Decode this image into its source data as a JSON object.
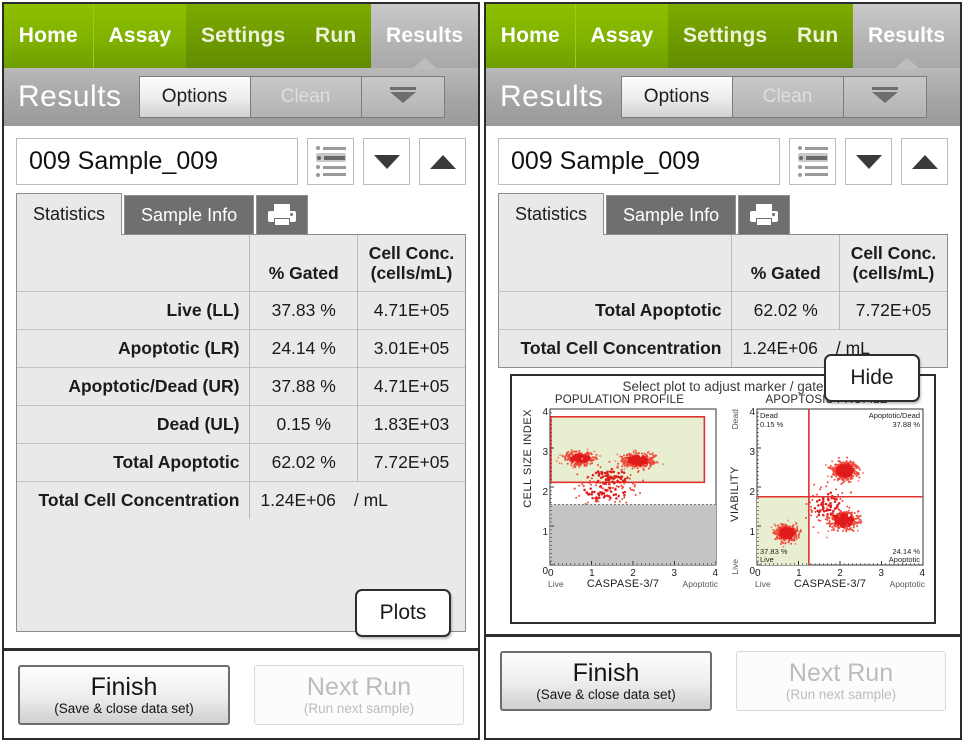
{
  "nav": {
    "tabs": [
      {
        "label": "Home",
        "state": "bright"
      },
      {
        "label": "Assay",
        "state": "bright"
      },
      {
        "label": "Settings",
        "state": "dark"
      },
      {
        "label": "Run",
        "state": "dark"
      },
      {
        "label": "Results",
        "state": "active"
      }
    ]
  },
  "titlebar": {
    "title": "Results",
    "options_label": "Options",
    "clean_label": "Clean",
    "more_icon": "chevron-down-icon"
  },
  "sample": {
    "value": "009 Sample_009",
    "list_icon": "list-icon",
    "prev_icon": "triangle-down-icon",
    "next_icon": "triangle-up-icon"
  },
  "tabs": {
    "statistics": "Statistics",
    "sample_info": "Sample Info",
    "print_icon": "printer-icon"
  },
  "table": {
    "headers": [
      "",
      "% Gated",
      "Cell Conc.\n(cells/mL)"
    ],
    "header_pct": "% Gated",
    "header_conc_line1": "Cell Conc.",
    "header_conc_line2": "(cells/mL)",
    "rows_full": [
      {
        "label": "Live (LL)",
        "pct": "37.83 %",
        "conc": "4.71E+05"
      },
      {
        "label": "Apoptotic (LR)",
        "pct": "24.14 %",
        "conc": "3.01E+05"
      },
      {
        "label": "Apoptotic/Dead (UR)",
        "pct": "37.88 %",
        "conc": "4.71E+05"
      },
      {
        "label": "Dead (UL)",
        "pct": "0.15 %",
        "conc": "1.83E+03"
      },
      {
        "label": "Total Apoptotic",
        "pct": "62.02 %",
        "conc": "7.72E+05"
      }
    ],
    "rows_compact": [
      {
        "label": "Total Apoptotic",
        "pct": "62.02 %",
        "conc": "7.72E+05"
      }
    ],
    "total": {
      "label": "Total Cell Concentration",
      "value": "1.24E+06",
      "unit": "/ mL"
    }
  },
  "callouts": {
    "plots": "Plots",
    "hide": "Hide"
  },
  "plots": {
    "hint": "Select plot to adjust marker / gate",
    "accent_red": "#e03131",
    "gate_fill": "#e8eed0",
    "dim_fill": "#c4c4c4"
  },
  "bottom": {
    "finish_main": "Finish",
    "finish_sub": "(Save & close data set)",
    "next_main": "Next Run",
    "next_sub": "(Run next sample)"
  },
  "chart_data": [
    {
      "type": "scatter",
      "title": "POPULATION PROFILE",
      "xlabel": "CASPASE-3/7",
      "ylabel": "CELL SIZE INDEX",
      "xlim": [
        0,
        4
      ],
      "ylim": [
        0,
        4
      ],
      "xticks": [
        0,
        1,
        2,
        3,
        4
      ],
      "yticks": [
        0,
        1,
        2,
        3,
        4
      ],
      "x_axis_low_label": "Live",
      "x_axis_high_label": "Apoptotic",
      "grid": false,
      "gate": {
        "x0": 0.02,
        "x1": 3.72,
        "y0": 2.12,
        "y1": 3.8,
        "fill": "#e8eed0",
        "stroke": "#e03131"
      },
      "dim_region": {
        "y0": 0.0,
        "y1": 1.55,
        "fill": "#c4c4c4"
      },
      "threshold_line_y": 1.55,
      "clusters": [
        {
          "cx": 0.72,
          "cy": 2.73,
          "sx": 0.3,
          "sy": 0.14,
          "n": 330
        },
        {
          "cx": 2.12,
          "cy": 2.68,
          "sx": 0.33,
          "sy": 0.16,
          "n": 360
        },
        {
          "cx": 1.45,
          "cy": 2.25,
          "sx": 0.55,
          "sy": 0.28,
          "n": 110
        },
        {
          "cx": 1.3,
          "cy": 1.85,
          "sx": 0.7,
          "sy": 0.22,
          "n": 70
        }
      ]
    },
    {
      "type": "scatter",
      "title": "APOPTOSIS PROFILE",
      "xlabel": "CASPASE-3/7",
      "ylabel": "VIABILITY",
      "xlim": [
        0,
        4
      ],
      "ylim": [
        0,
        4
      ],
      "xticks": [
        0,
        1,
        2,
        3,
        4
      ],
      "yticks": [
        0,
        1,
        2,
        3,
        4
      ],
      "x_axis_low_label": "Live",
      "x_axis_high_label": "Apoptotic",
      "y_axis_low_label": "Live",
      "y_axis_high_label": "Dead",
      "grid": false,
      "quadrant_x": 1.25,
      "quadrant_y": 1.75,
      "quadrant_fill_ll": "#e8eed0",
      "quadrants": [
        {
          "pos": "upper-left",
          "name": "Dead",
          "value": "0.15 %"
        },
        {
          "pos": "upper-right",
          "name": "Apoptotic/Dead",
          "value": "37.88 %"
        },
        {
          "pos": "lower-left",
          "name": "Live",
          "value": "37.83 %"
        },
        {
          "pos": "lower-right",
          "name": "Apoptotic",
          "value": "24.14 %"
        }
      ],
      "clusters": [
        {
          "cx": 0.72,
          "cy": 0.82,
          "sx": 0.24,
          "sy": 0.2,
          "n": 320
        },
        {
          "cx": 2.12,
          "cy": 2.42,
          "sx": 0.26,
          "sy": 0.22,
          "n": 330
        },
        {
          "cx": 2.1,
          "cy": 1.15,
          "sx": 0.3,
          "sy": 0.22,
          "n": 300
        },
        {
          "cx": 1.7,
          "cy": 1.55,
          "sx": 0.4,
          "sy": 0.45,
          "n": 90
        }
      ]
    }
  ]
}
